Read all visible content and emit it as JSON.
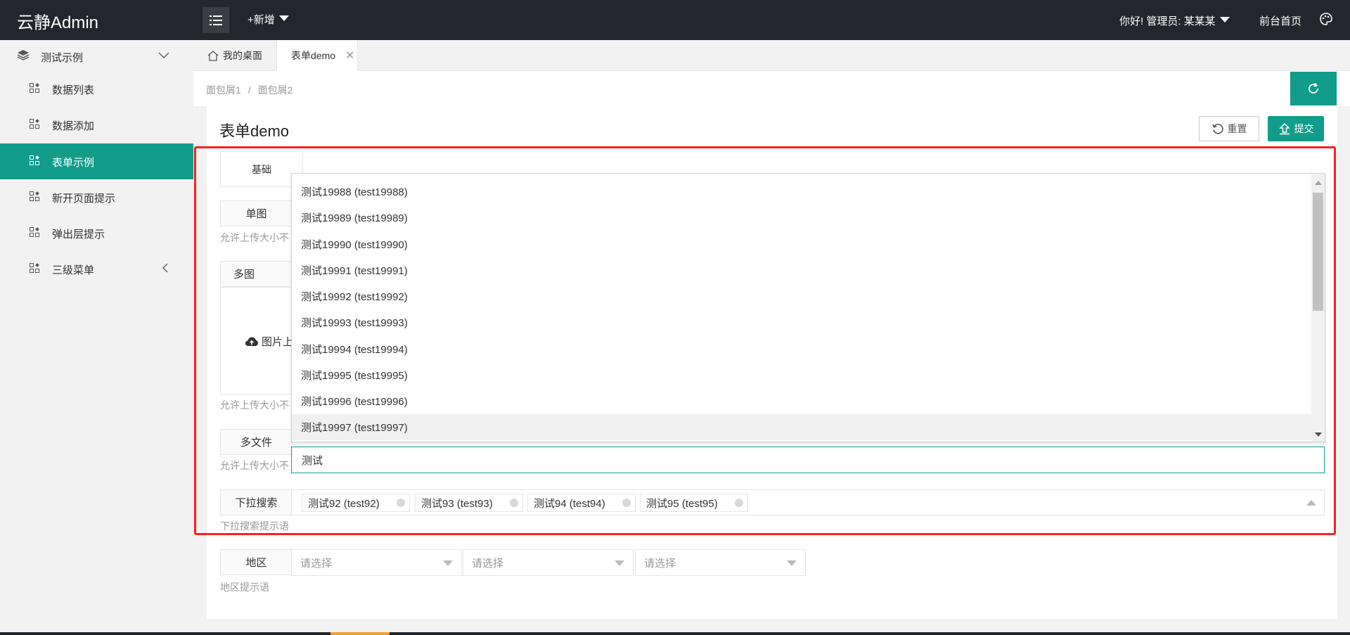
{
  "header": {
    "logo": "云静Admin",
    "new_label": "+新增",
    "user_label": "你好! 管理员: 某某某",
    "front_link": "前台首页"
  },
  "sidebar": {
    "group_label": "测试示例",
    "items": [
      {
        "label": "数据列表",
        "active": false
      },
      {
        "label": "数据添加",
        "active": false
      },
      {
        "label": "表单示例",
        "active": true
      },
      {
        "label": "新开页面提示",
        "active": false
      },
      {
        "label": "弹出层提示",
        "active": false
      },
      {
        "label": "三级菜单",
        "active": false
      }
    ]
  },
  "tabs": {
    "home": "我的桌面",
    "form": "表单demo"
  },
  "breadcrumb": {
    "first": "面包屑1",
    "separator": "/",
    "second": "面包屑2"
  },
  "panel": {
    "title": "表单demo",
    "reset_label": "重置",
    "submit_label": "提交"
  },
  "form": {
    "subtab": "基础",
    "single_image_label": "单图",
    "single_image_hint": "允许上传大小不",
    "multi_image_label": "多图",
    "upload_text": "图片上",
    "multi_image_hint": "允许上传大小不",
    "multi_file_label": "多文件",
    "multi_file_hint": "允许上传大小不",
    "dropdown_label": "下拉搜索",
    "dropdown_hint": "下拉搜索提示语",
    "region_label": "地区",
    "region_hint": "地区提示语",
    "region_placeholder": "请选择"
  },
  "dropdown": {
    "options": [
      "测试19988 (test19988)",
      "测试19989 (test19989)",
      "测试19990 (test19990)",
      "测试19991 (test19991)",
      "测试19992 (test19992)",
      "测试19993 (test19993)",
      "测试19994 (test19994)",
      "测试19995 (test19995)",
      "测试19996 (test19996)",
      "测试19997 (test19997)"
    ],
    "hovered_index": 9,
    "search_value": "测试"
  },
  "selected_chips": [
    "测试92 (test92)",
    "测试93 (test93)",
    "测试94 (test94)",
    "测试95 (test95)"
  ],
  "colors": {
    "accent": "#129d8a",
    "header_bg": "#23262e",
    "highlight_border": "#ff2020"
  }
}
